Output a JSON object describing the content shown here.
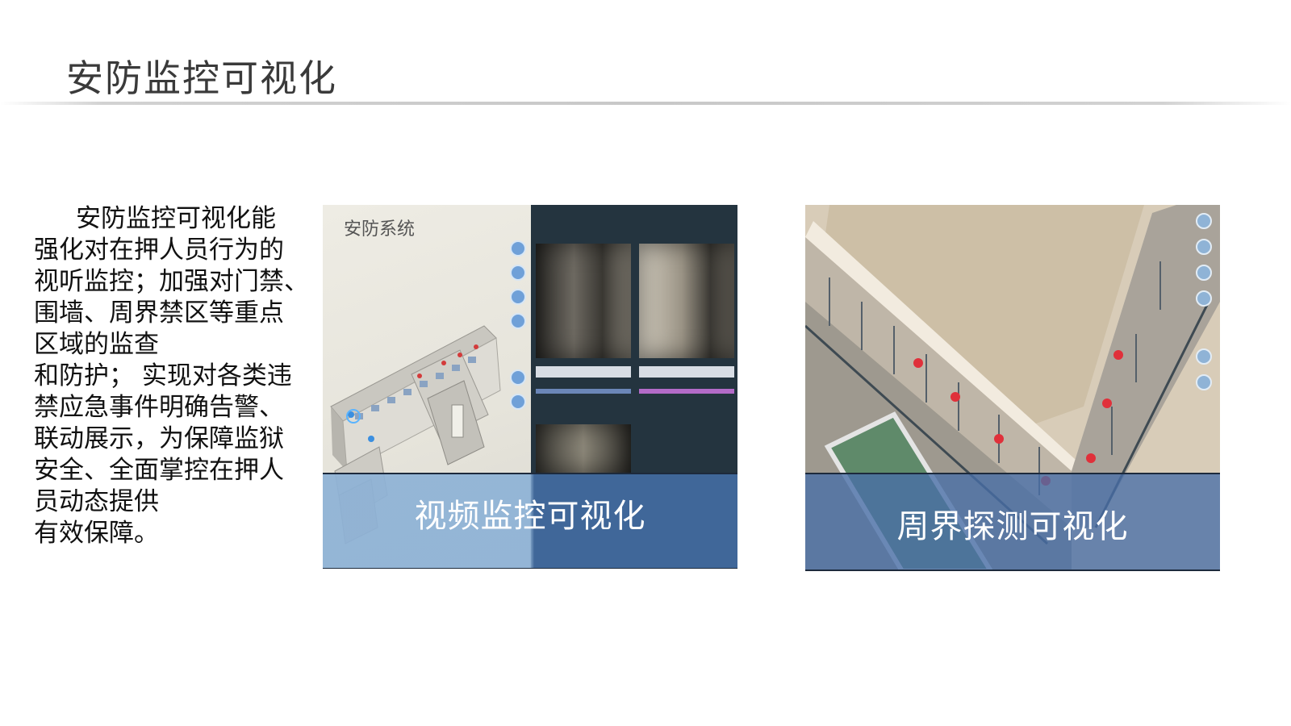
{
  "page": {
    "title": "安防监控可视化"
  },
  "body": {
    "paragraph_lines": [
      "安防监控可视化能",
      "强化对在押人员行为的",
      "视听监控；加强对门禁、",
      "围墙、周界禁区等重点",
      "区域的监查",
      "和防护； 实现对各类违",
      "禁应急事件明确告警、",
      "联动展示，为保障监狱",
      "安全、全面掌控在押人",
      "员动态提供",
      "有效保障。"
    ]
  },
  "figures": [
    {
      "screen_label": "安防系统",
      "caption": "视频监控可视化"
    },
    {
      "caption": "周界探测可视化"
    }
  ]
}
